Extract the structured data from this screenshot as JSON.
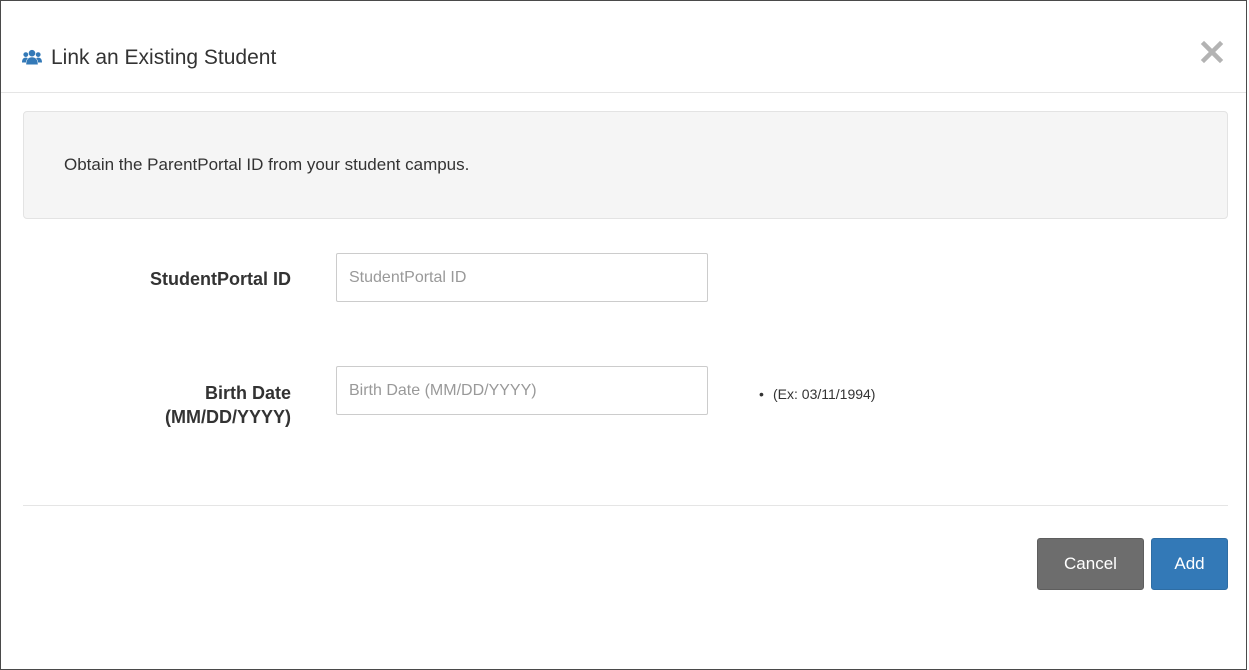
{
  "dialog": {
    "title": "Link an Existing Student",
    "header_icon": "users-icon",
    "close_icon": "close-icon",
    "accent_color": "#3379b7"
  },
  "info": {
    "message": "Obtain the ParentPortal ID from your student campus."
  },
  "form": {
    "student_id": {
      "label": "StudentPortal ID",
      "placeholder": "StudentPortal ID",
      "value": ""
    },
    "birth_date": {
      "label_line1": "Birth Date",
      "label_line2": "(MM/DD/YYYY)",
      "placeholder": "Birth Date (MM/DD/YYYY)",
      "value": "",
      "hint": "(Ex: 03/11/1994)"
    }
  },
  "footer": {
    "cancel_label": "Cancel",
    "add_label": "Add",
    "cancel_color": "#6d6d6d",
    "add_color": "#3379b7"
  }
}
